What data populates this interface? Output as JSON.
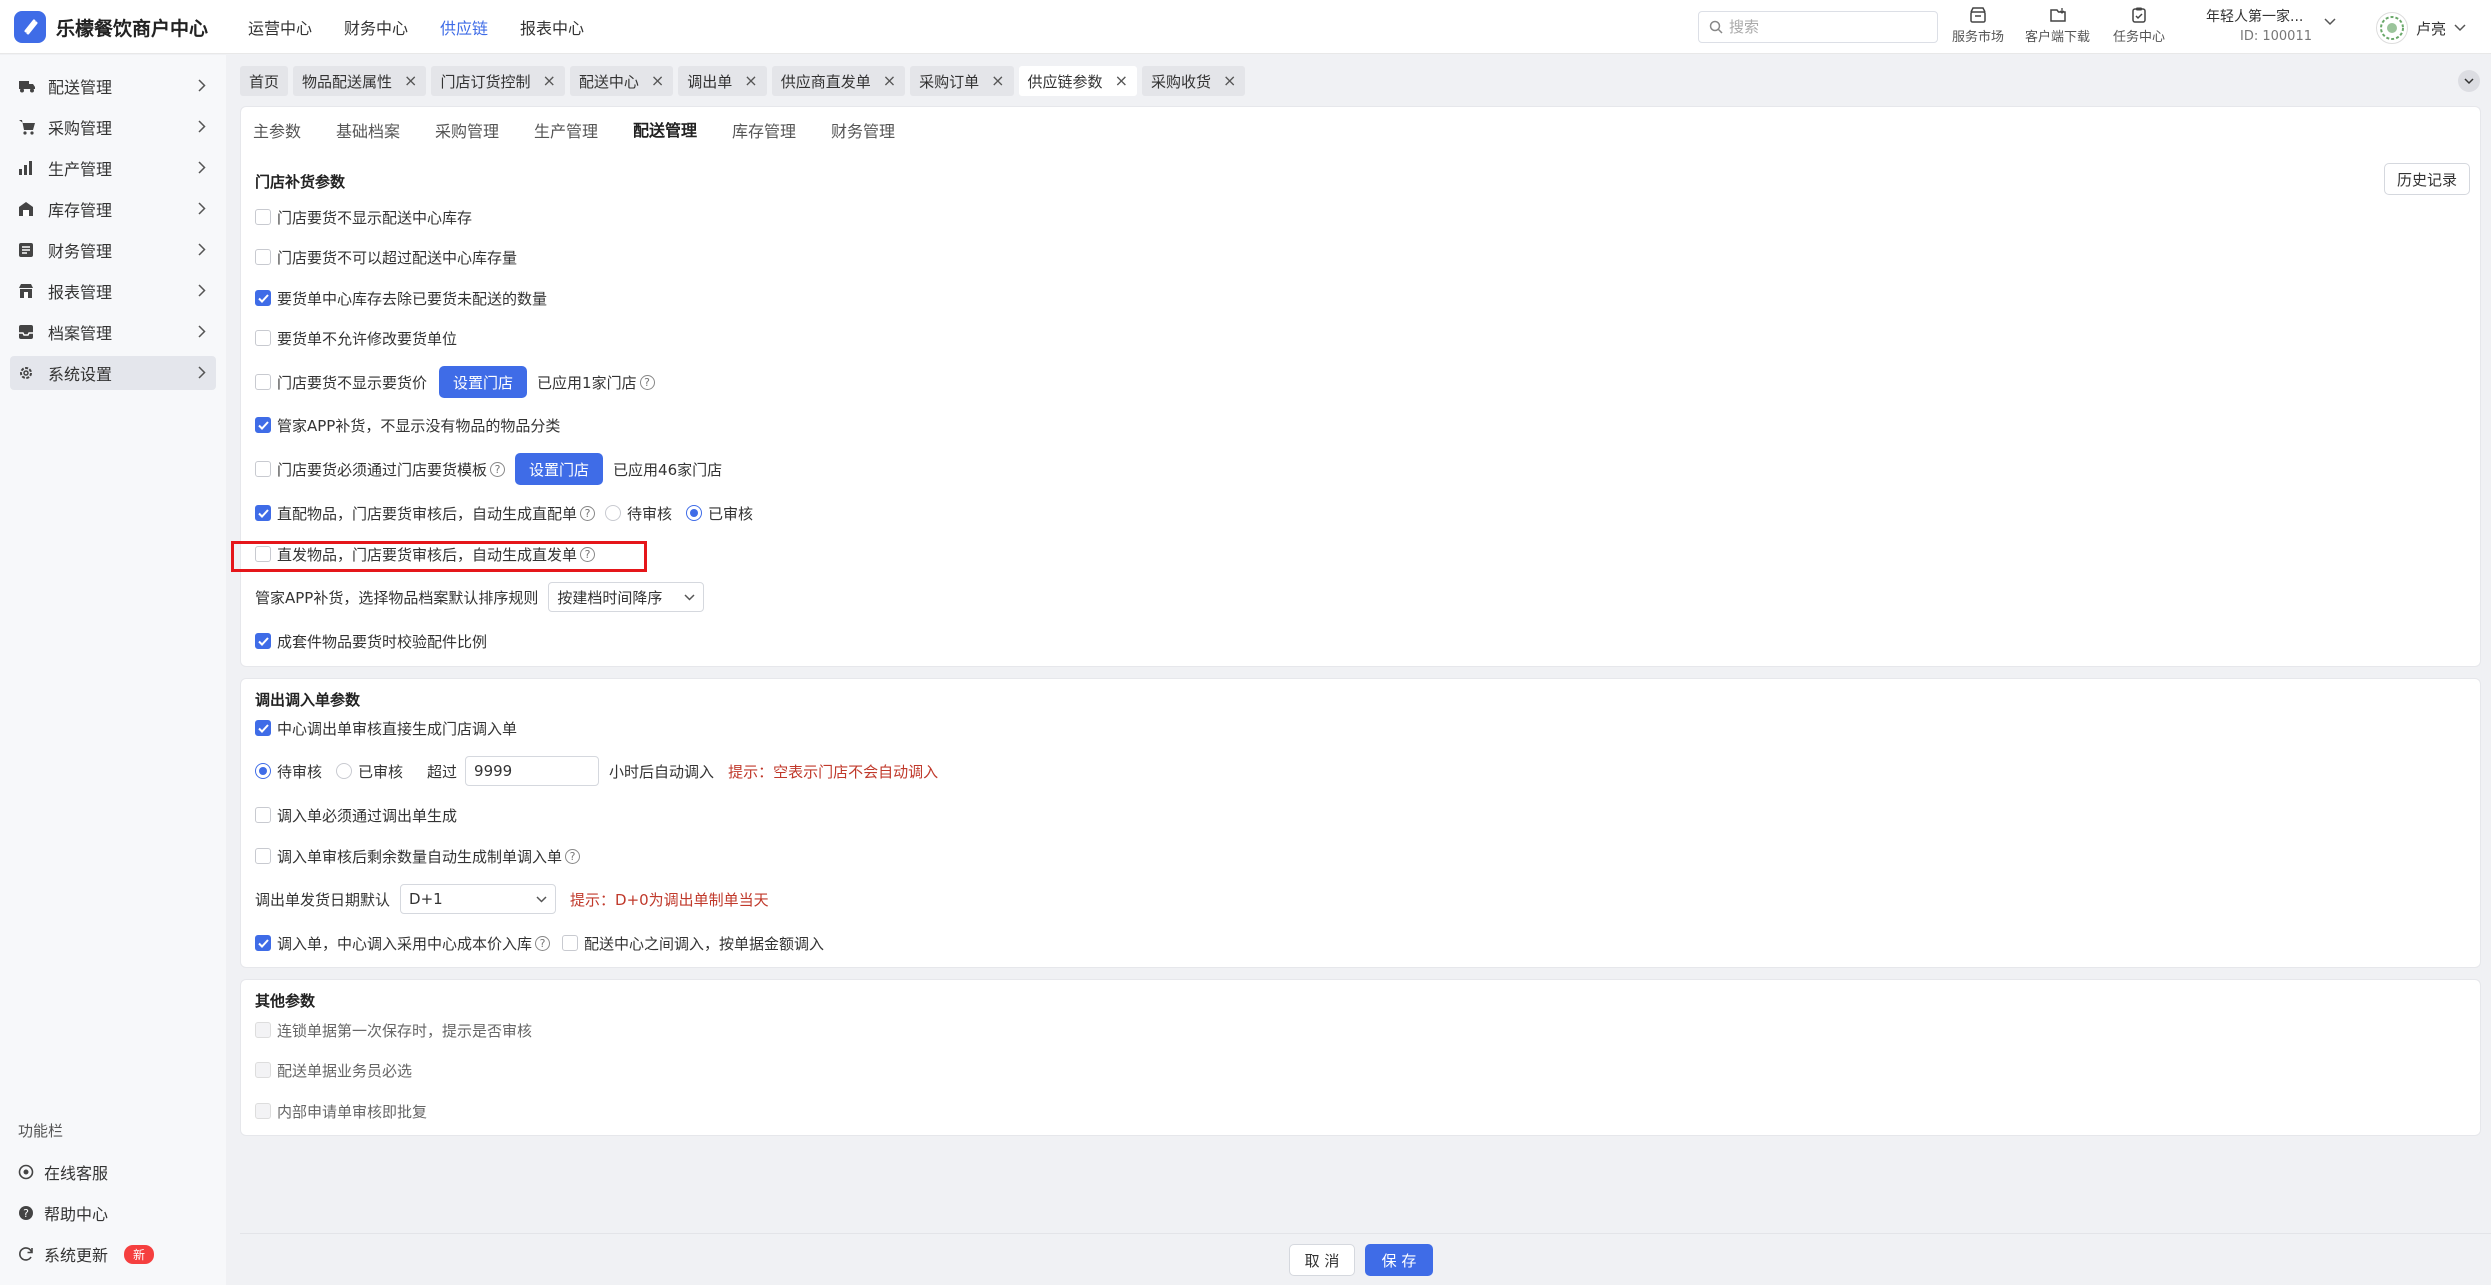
{
  "app": {
    "title": "乐檬餐饮商户中心"
  },
  "top_nav": [
    {
      "label": "运营中心",
      "active": false
    },
    {
      "label": "财务中心",
      "active": false
    },
    {
      "label": "供应链",
      "active": true
    },
    {
      "label": "报表中心",
      "active": false
    }
  ],
  "search": {
    "placeholder": "搜索"
  },
  "tools": [
    {
      "label": "服务市场",
      "icon": "store-icon"
    },
    {
      "label": "客户端下载",
      "icon": "download-icon"
    },
    {
      "label": "任务中心",
      "icon": "task-icon"
    }
  ],
  "user": {
    "org": "年轻人第一家...",
    "id": "ID: 100011",
    "name": "卢亮"
  },
  "sidebar": {
    "items": [
      {
        "label": "配送管理",
        "icon": "truck-icon"
      },
      {
        "label": "采购管理",
        "icon": "cart-icon"
      },
      {
        "label": "生产管理",
        "icon": "chart-icon"
      },
      {
        "label": "库存管理",
        "icon": "warehouse-icon"
      },
      {
        "label": "财务管理",
        "icon": "finance-icon"
      },
      {
        "label": "报表管理",
        "icon": "report-icon"
      },
      {
        "label": "档案管理",
        "icon": "archive-icon"
      },
      {
        "label": "系统设置",
        "icon": "gear-icon",
        "active": true
      }
    ],
    "function_title": "功能栏",
    "functions": [
      {
        "label": "在线客服",
        "icon": "headset-icon"
      },
      {
        "label": "帮助中心",
        "icon": "help-icon"
      },
      {
        "label": "系统更新",
        "icon": "refresh-icon",
        "badge": "新"
      }
    ]
  },
  "tabs": [
    {
      "label": "首页",
      "closable": false
    },
    {
      "label": "物品配送属性",
      "closable": true
    },
    {
      "label": "门店订货控制",
      "closable": true
    },
    {
      "label": "配送中心",
      "closable": true
    },
    {
      "label": "调出单",
      "closable": true
    },
    {
      "label": "供应商直发单",
      "closable": true
    },
    {
      "label": "采购订单",
      "closable": true
    },
    {
      "label": "供应链参数",
      "closable": true,
      "active": true
    },
    {
      "label": "采购收货",
      "closable": true
    }
  ],
  "sub_tabs": [
    "主参数",
    "基础档案",
    "采购管理",
    "生产管理",
    "配送管理",
    "库存管理",
    "财务管理"
  ],
  "sub_tab_active": "配送管理",
  "history_button": "历史记录",
  "store_section": {
    "title": "门店补货参数",
    "opt1": "门店要货不显示配送中心库存",
    "opt2": "门店要货不可以超过配送中心库存量",
    "opt3": "要货单中心库存去除已要货未配送的数量",
    "opt4": "要货单不允许修改要货单位",
    "opt5": "门店要货不显示要货价",
    "opt5_button": "设置门店",
    "opt5_applied": "已应用1家门店",
    "opt6": "管家APP补货，不显示没有物品的物品分类",
    "opt7": "门店要货必须通过门店要货模板",
    "opt7_button": "设置门店",
    "opt7_applied": "已应用46家门店",
    "opt8": "直配物品，门店要货审核后，自动生成直配单",
    "opt8_radio1": "待审核",
    "opt8_radio2": "已审核",
    "opt9": "直发物品，门店要货审核后，自动生成直发单",
    "sort_label": "管家APP补货，选择物品档案默认排序规则",
    "sort_value": "按建档时间降序",
    "opt10": "成套件物品要货时校验配件比例"
  },
  "transfer_section": {
    "title": "调出调入单参数",
    "opt1": "中心调出单审核直接生成门店调入单",
    "radio1": "待审核",
    "radio2": "已审核",
    "over_label": "超过",
    "hours_value": "9999",
    "hours_suffix": "小时后自动调入",
    "hours_hint": "提示：空表示门店不会自动调入",
    "opt2": "调入单必须通过调出单生成",
    "opt3": "调入单审核后剩余数量自动生成制单调入单",
    "date_label": "调出单发货日期默认",
    "date_value": "D+1",
    "date_hint": "提示：D+0为调出单制单当天",
    "opt4": "调入单，中心调入采用中心成本价入库",
    "opt5": "配送中心之间调入，按单据金额调入"
  },
  "other_section": {
    "title": "其他参数",
    "opt1": "连锁单据第一次保存时，提示是否审核",
    "opt2": "配送单据业务员必选",
    "opt3": "内部申请单审核即批复"
  },
  "footer": {
    "cancel": "取 消",
    "save": "保 存"
  },
  "colors": {
    "accent": "#3f6ce7",
    "highlight": "#e5161a",
    "hint": "#c0392b"
  }
}
